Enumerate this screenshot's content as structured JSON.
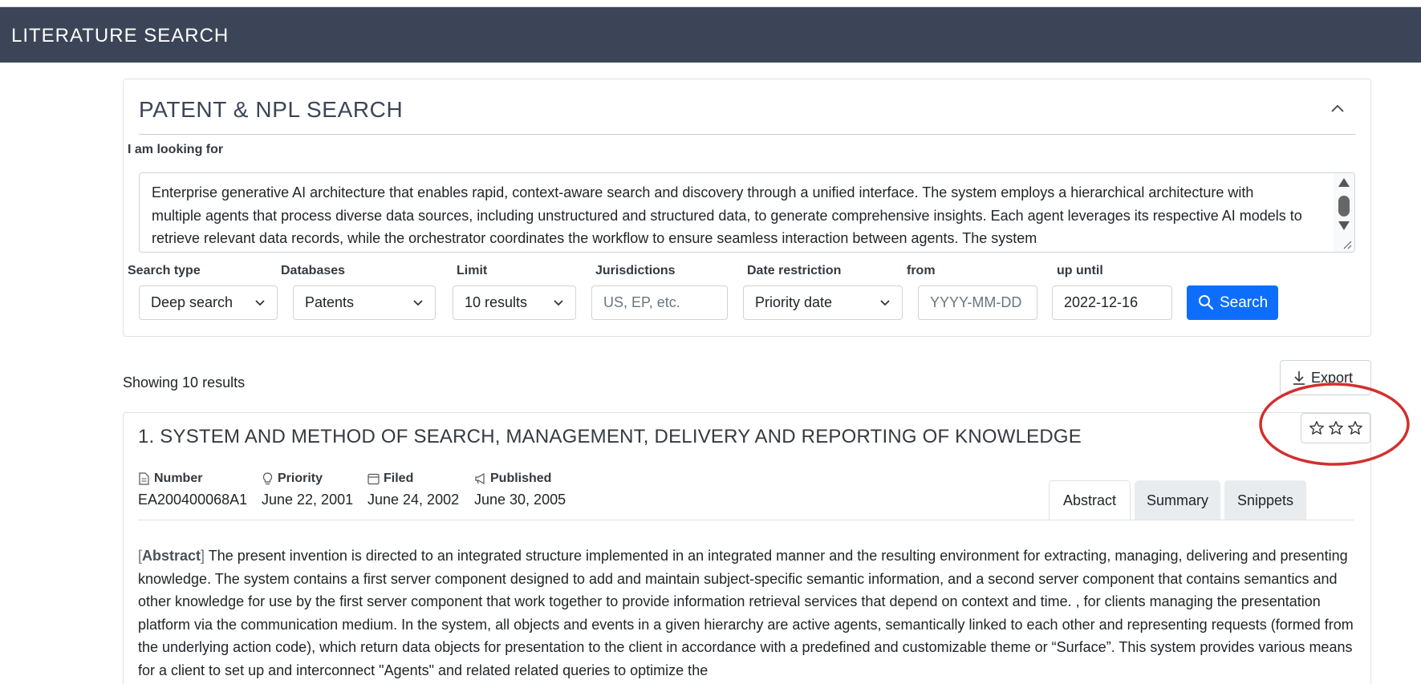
{
  "header": {
    "title": "LITERATURE SEARCH"
  },
  "search_panel": {
    "title": "PATENT & NPL SEARCH",
    "query_label": "I am looking for",
    "query_text": "Enterprise generative AI architecture that enables rapid, context-aware search and discovery through a unified interface. The system employs a hierarchical architecture with multiple agents that process diverse data sources, including unstructured and structured data, to generate comprehensive insights. Each agent leverages its respective AI models to retrieve relevant data records, while the orchestrator coordinates the workflow to ensure seamless interaction between agents. The system",
    "fields": {
      "search_type": {
        "label": "Search type",
        "value": "Deep search"
      },
      "databases": {
        "label": "Databases",
        "value": "Patents"
      },
      "limit": {
        "label": "Limit",
        "value": "10 results"
      },
      "jurisdictions": {
        "label": "Jurisdictions",
        "placeholder": "US, EP, etc."
      },
      "date_restriction": {
        "label": "Date restriction",
        "value": "Priority date"
      },
      "from": {
        "label": "from",
        "placeholder": "YYYY-MM-DD"
      },
      "up_until": {
        "label": "up until",
        "value": "2022-12-16"
      }
    },
    "search_button": "Search"
  },
  "results": {
    "count_text": "Showing 10 results",
    "export_label": "Export",
    "items": [
      {
        "title": "1. SYSTEM AND METHOD OF SEARCH, MANAGEMENT, DELIVERY AND REPORTING OF KNOWLEDGE",
        "rating": 0,
        "rating_max": 3,
        "meta": {
          "number_label": "Number",
          "number": "EA200400068A1",
          "priority_label": "Priority",
          "priority": "June 22, 2001",
          "filed_label": "Filed",
          "filed": "June 24, 2002",
          "published_label": "Published",
          "published": "June 30, 2005"
        },
        "tabs": [
          "Abstract",
          "Summary",
          "Snippets"
        ],
        "active_tab": "Abstract",
        "abstract_tag": "Abstract",
        "abstract_text": "The present invention is directed to an integrated structure implemented in an integrated manner and the resulting environment for extracting, managing, delivering and presenting knowledge. The system contains a first server component designed to add and maintain subject-specific semantic information, and a second server component that contains semantics and other knowledge for use by the first server component that work together to provide information retrieval services that depend on context and time. , for clients managing the presentation platform via the communication medium. In the system, all objects and events in a given hierarchy are active agents, semantically linked to each other and representing requests (formed from the underlying action code), which return data objects for presentation to the client in accordance with a predefined and customizable theme or “Surface”. This system provides various means for a client to set up and interconnect \"Agents\" and related related queries to optimize the"
      }
    ]
  },
  "colors": {
    "header_bg": "#3b4557",
    "primary": "#0d6efd",
    "annotation": "#d32f2f"
  }
}
